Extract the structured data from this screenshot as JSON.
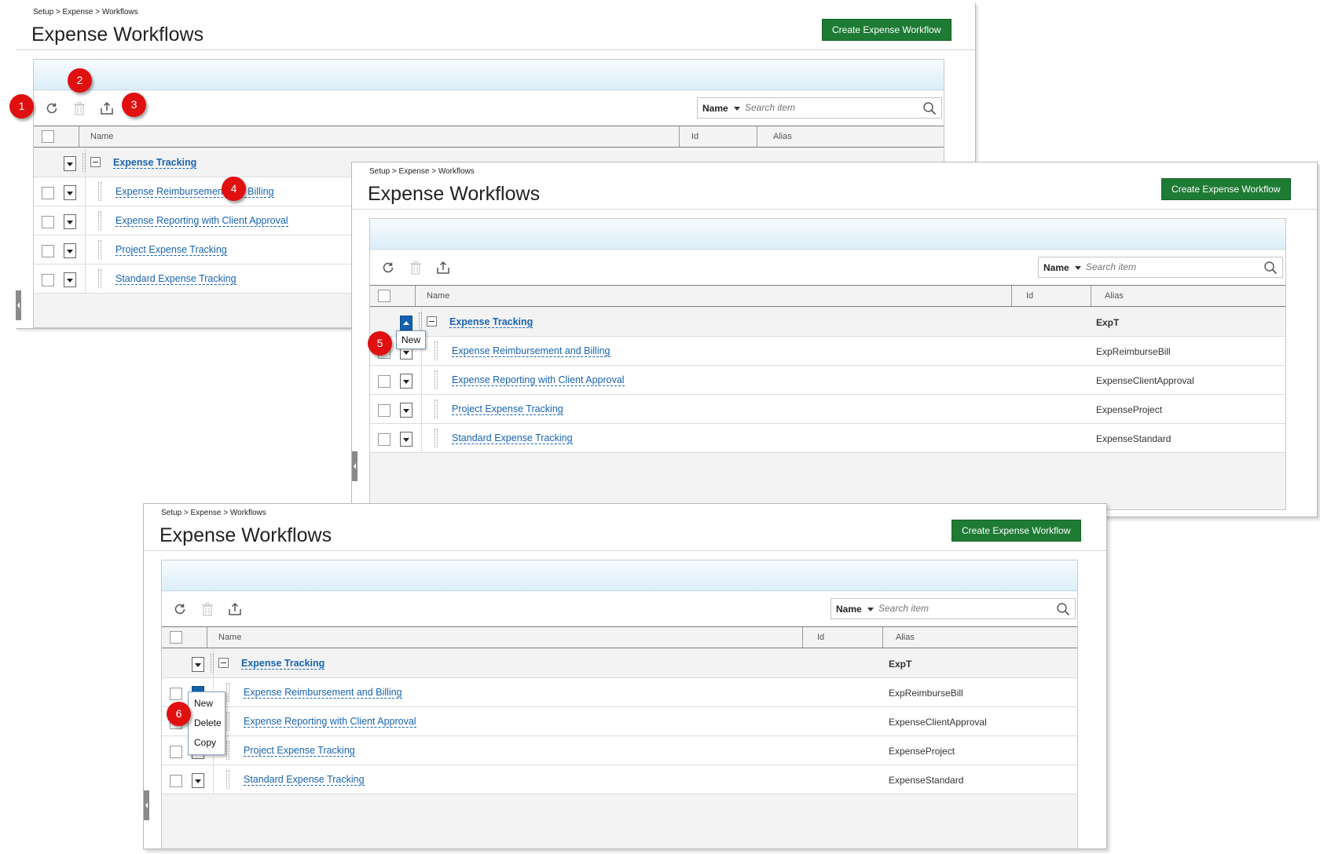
{
  "breadcrumb": "Setup > Expense > Workflows",
  "page_title": "Expense Workflows",
  "create_button": "Create Expense Workflow",
  "search": {
    "field": "Name",
    "placeholder": "Search item"
  },
  "columns": {
    "name": "Name",
    "id": "Id",
    "alias": "Alias"
  },
  "group": {
    "name": "Expense Tracking",
    "alias": "ExpT"
  },
  "rows": [
    {
      "name": "Expense Reimbursement and Billing",
      "alias": "ExpReimburseBill"
    },
    {
      "name": "Expense Reporting with Client Approval",
      "alias": "ExpenseClientApproval"
    },
    {
      "name": "Project Expense Tracking",
      "alias": "ExpenseProject"
    },
    {
      "name": "Standard Expense Tracking",
      "alias": "ExpenseStandard"
    }
  ],
  "tooltip_new": "New",
  "context_menu": [
    "New",
    "Delete",
    "Copy"
  ],
  "callouts": [
    "1",
    "2",
    "3",
    "4",
    "5",
    "6"
  ],
  "colors": {
    "brand_green": "#1e7b34",
    "link_blue": "#1763b0",
    "callout_red": "#e01010"
  },
  "icons": [
    "refresh-icon",
    "delete-icon",
    "export-icon",
    "search-icon",
    "collapse-icon",
    "dropdown-icon"
  ]
}
